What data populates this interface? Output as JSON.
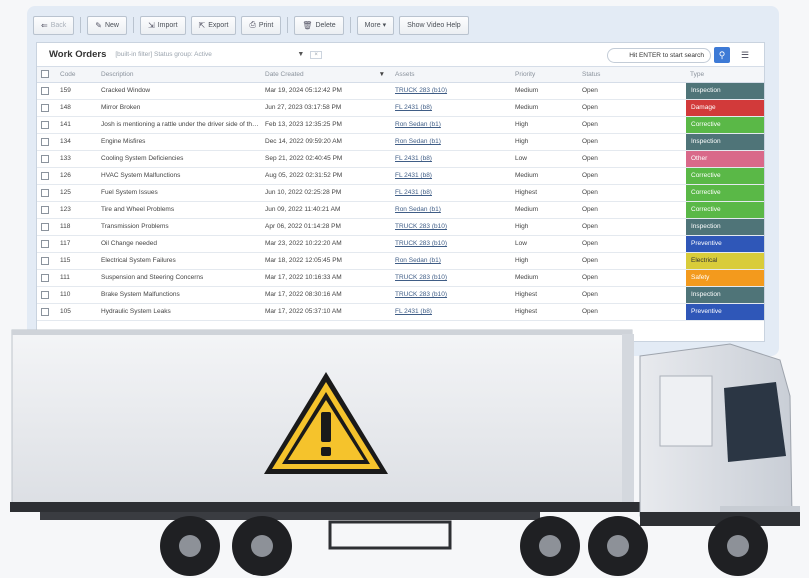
{
  "toolbar": {
    "buttons": [
      "Back",
      "New",
      "Import",
      "Export",
      "Print",
      "Delete",
      "More ▾",
      "Show Video Help"
    ]
  },
  "grid": {
    "title": "Work Orders",
    "filter_text": "[built-in filter] Status group: Active",
    "search_placeholder": "Hit ENTER to start search",
    "columns": [
      "Code",
      "Description",
      "Date Created",
      "Assets",
      "Priority",
      "Status",
      "Type"
    ],
    "rows": [
      {
        "code": "159",
        "description": "Cracked Window",
        "date": "Mar 19, 2024 05:12:42 PM",
        "asset": "TRUCK 283 (b10)",
        "priority": "Medium",
        "status": "Open",
        "type": "Inspection"
      },
      {
        "code": "148",
        "description": "Mirror Broken",
        "date": "Jun 27, 2023 03:17:58 PM",
        "asset": "FL 2431 (b8)",
        "priority": "Medium",
        "status": "Open",
        "type": "Damage"
      },
      {
        "code": "141",
        "description": "Josh is mentioning a rattle under the driver side of the truck",
        "date": "Feb 13, 2023 12:35:25 PM",
        "asset": "Ron Sedan (b1)",
        "priority": "High",
        "status": "Open",
        "type": "Corrective"
      },
      {
        "code": "134",
        "description": "Engine Misfires",
        "date": "Dec 14, 2022 09:59:20 AM",
        "asset": "Ron Sedan (b1)",
        "priority": "High",
        "status": "Open",
        "type": "Inspection"
      },
      {
        "code": "133",
        "description": "Cooling System Deficiencies",
        "date": "Sep 21, 2022 02:40:45 PM",
        "asset": "FL 2431 (b8)",
        "priority": "Low",
        "status": "Open",
        "type": "Other"
      },
      {
        "code": "126",
        "description": "HVAC System Malfunctions",
        "date": "Aug 05, 2022 02:31:52 PM",
        "asset": "FL 2431 (b8)",
        "priority": "Medium",
        "status": "Open",
        "type": "Corrective"
      },
      {
        "code": "125",
        "description": "Fuel System Issues",
        "date": "Jun 10, 2022 02:25:28 PM",
        "asset": "FL 2431 (b8)",
        "priority": "Highest",
        "status": "Open",
        "type": "Corrective"
      },
      {
        "code": "123",
        "description": "Tire and Wheel Problems",
        "date": "Jun 09, 2022 11:40:21 AM",
        "asset": "Ron Sedan (b1)",
        "priority": "Medium",
        "status": "Open",
        "type": "Corrective"
      },
      {
        "code": "118",
        "description": "Transmission Problems",
        "date": "Apr 06, 2022 01:14:28 PM",
        "asset": "TRUCK 283 (b10)",
        "priority": "High",
        "status": "Open",
        "type": "Inspection"
      },
      {
        "code": "117",
        "description": "Oil Change needed",
        "date": "Mar 23, 2022 10:22:20 AM",
        "asset": "TRUCK 283 (b10)",
        "priority": "Low",
        "status": "Open",
        "type": "Preventive"
      },
      {
        "code": "115",
        "description": "Electrical System Failures",
        "date": "Mar 18, 2022 12:05:45 PM",
        "asset": "Ron Sedan (b1)",
        "priority": "High",
        "status": "Open",
        "type": "Electrical"
      },
      {
        "code": "111",
        "description": "Suspension and Steering Concerns",
        "date": "Mar 17, 2022 10:16:33 AM",
        "asset": "TRUCK 283 (b10)",
        "priority": "Medium",
        "status": "Open",
        "type": "Safety"
      },
      {
        "code": "110",
        "description": "Brake System Malfunctions",
        "date": "Mar 17, 2022 08:30:16 AM",
        "asset": "TRUCK 283 (b10)",
        "priority": "Highest",
        "status": "Open",
        "type": "Inspection"
      },
      {
        "code": "105",
        "description": "Hydraulic System Leaks",
        "date": "Mar 17, 2022 05:37:10 AM",
        "asset": "FL 2431 (b8)",
        "priority": "Highest",
        "status": "Open",
        "type": "Preventive"
      }
    ]
  },
  "type_colors": {
    "Inspection": "#4f7478",
    "Damage": "#d23a3a",
    "Corrective": "#5ab847",
    "Other": "#d9698a",
    "Preventive": "#2f57b8",
    "Electrical": "#d9cc3a",
    "Safety": "#f39a1d"
  },
  "icons": [
    "back-arrow-icon",
    "new-icon",
    "import-icon",
    "export-icon",
    "print-icon",
    "delete-icon",
    "search-icon",
    "menu-icon",
    "warning-icon"
  ]
}
